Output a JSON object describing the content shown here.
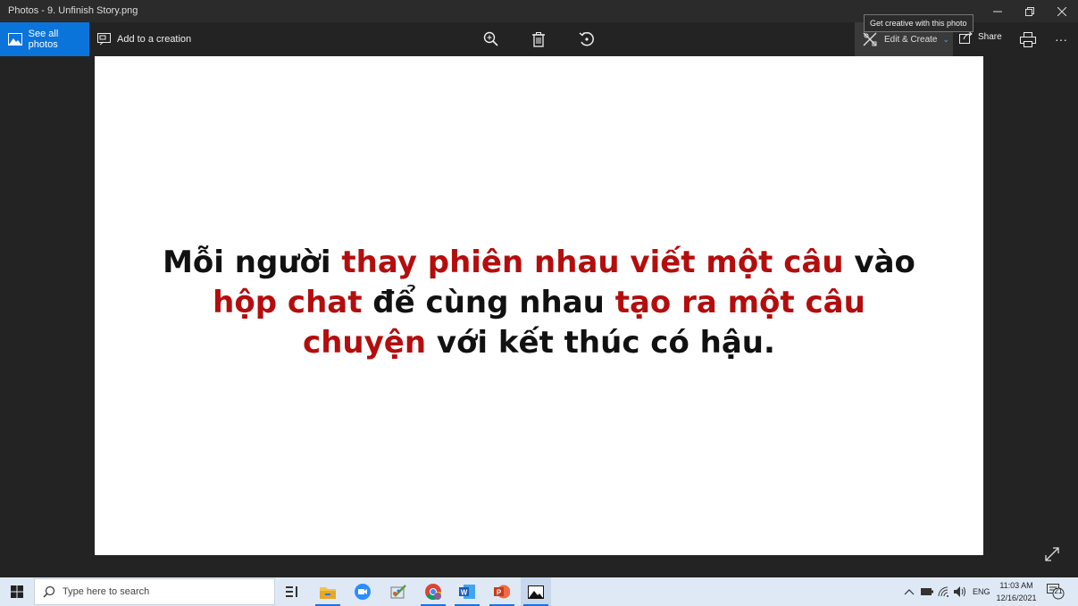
{
  "window": {
    "title": "Photos - 9. Unfinish Story.png"
  },
  "toolbar": {
    "see_all_label": "See all photos",
    "add_creation_label": "Add to a creation",
    "edit_create_label": "Edit & Create",
    "share_label": "Share",
    "tooltip": "Get creative with this photo",
    "more_label": "···"
  },
  "image": {
    "line1_black_a": "Mỗi người ",
    "line1_red": "thay phiên nhau viết một câu",
    "line1_black_b": " vào",
    "line2_red_a": "hộp chat",
    "line2_black": " để cùng nhau ",
    "line2_red_b": "tạo ra một câu",
    "line3_red": "chuyện",
    "line3_black": " với kết thúc có hậu.",
    "red_color": "#b40d0d",
    "text_color": "#111111"
  },
  "taskbar": {
    "search_placeholder": "Type here to search",
    "language": "ENG",
    "time": "11:03 AM",
    "date": "12/16/2021",
    "notification_count": "21"
  },
  "colors": {
    "accent": "#0a74da",
    "taskbar": "#dfe9f5"
  }
}
